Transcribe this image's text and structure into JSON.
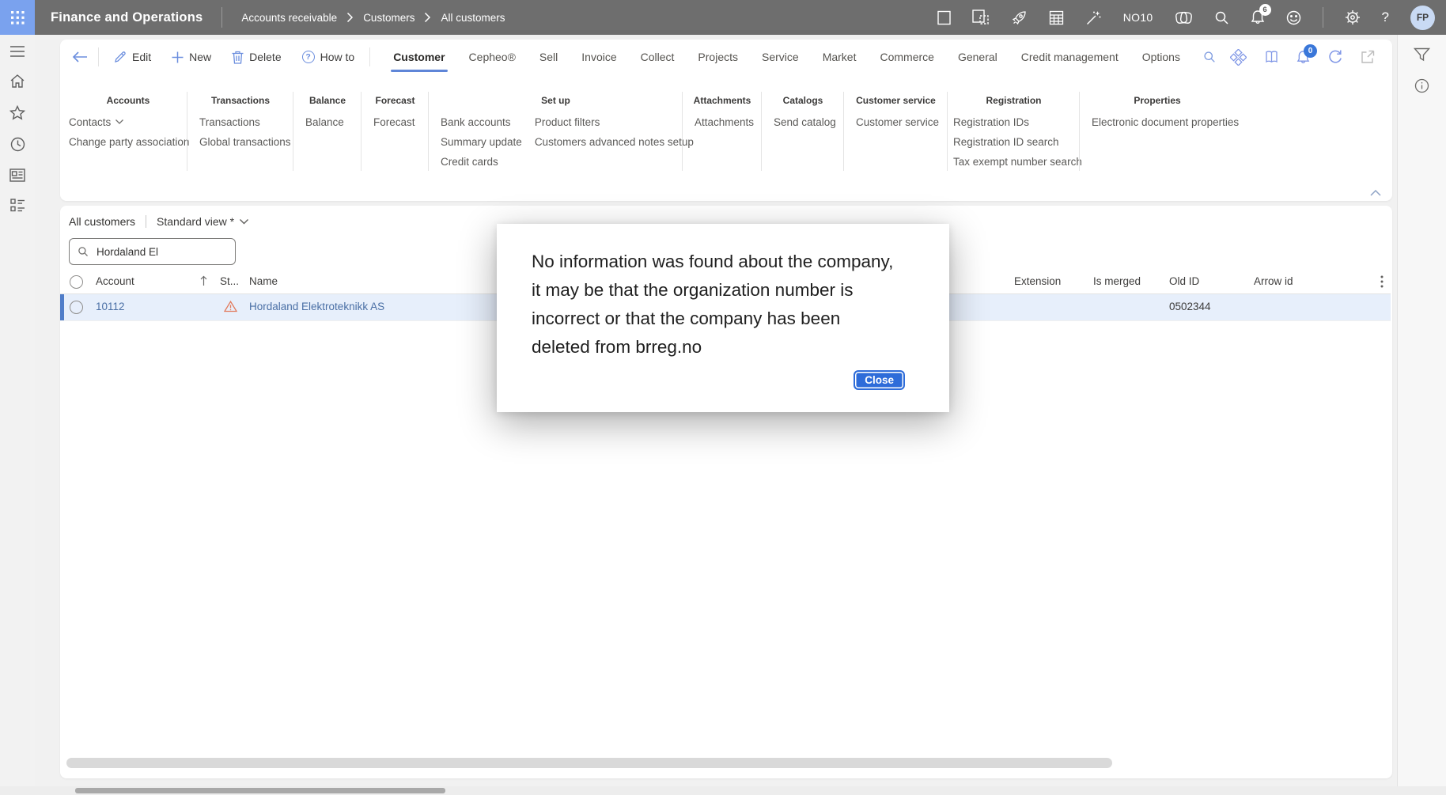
{
  "colors": {
    "navbar": "#6e6e6e",
    "waffle_button": "#7aa2ee",
    "accent_blue": "#5f86d8",
    "link_blue": "#4a6fa5",
    "row_selection": "#e7effb",
    "warning_orange": "#e2795b",
    "dialog_button": "#2e6cd9"
  },
  "icons": {
    "help_glyph": "?"
  },
  "topbar": {
    "app_title": "Finance and Operations",
    "breadcrumb": [
      "Accounts receivable",
      "Customers",
      "All customers"
    ],
    "environment": "NO10",
    "notification_count": "6",
    "user_initials": "FP",
    "icon_names": [
      "fullscreen-icon",
      "devices-icon",
      "rocket-icon",
      "calculator-icon",
      "wand-icon",
      "copilot-icon",
      "search-icon",
      "notifications-bell-icon",
      "feedback-smiley-icon",
      "settings-gear-icon",
      "help-icon",
      "avatar"
    ]
  },
  "sidebar": {
    "icon_names": [
      "menu-hamburger-icon",
      "home-icon",
      "favorites-star-icon",
      "recent-clock-icon",
      "workspaces-icon",
      "modules-icon"
    ]
  },
  "actionbar": {
    "buttons": {
      "edit": "Edit",
      "new": "New",
      "delete": "Delete",
      "howto": "How to"
    },
    "tabs": [
      {
        "label": "Customer",
        "selected": true
      },
      {
        "label": "Cepheo®",
        "selected": false
      },
      {
        "label": "Sell",
        "selected": false
      },
      {
        "label": "Invoice",
        "selected": false
      },
      {
        "label": "Collect",
        "selected": false
      },
      {
        "label": "Projects",
        "selected": false
      },
      {
        "label": "Service",
        "selected": false
      },
      {
        "label": "Market",
        "selected": false
      },
      {
        "label": "Commerce",
        "selected": false
      },
      {
        "label": "General",
        "selected": false
      },
      {
        "label": "Credit management",
        "selected": false
      },
      {
        "label": "Options",
        "selected": false
      }
    ],
    "message_badge": "0",
    "right_icon_names": [
      "apps-diamond-icon",
      "book-icon",
      "messages-bell-icon",
      "refresh-icon",
      "open-in-new-icon"
    ]
  },
  "ribbon": {
    "groups": [
      {
        "title": "Accounts",
        "columns": [
          [
            "Contacts",
            "Change party association"
          ]
        ]
      },
      {
        "title": "Transactions",
        "columns": [
          [
            "Transactions",
            "Global transactions"
          ]
        ]
      },
      {
        "title": "Balance",
        "columns": [
          [
            "Balance"
          ]
        ]
      },
      {
        "title": "Forecast",
        "columns": [
          [
            "Forecast"
          ]
        ]
      },
      {
        "title": "Set up",
        "columns": [
          [
            "Bank accounts",
            "Summary update",
            "Credit cards"
          ],
          [
            "Product filters",
            "Customers advanced notes setup"
          ]
        ]
      },
      {
        "title": "Attachments",
        "columns": [
          [
            "Attachments"
          ]
        ]
      },
      {
        "title": "Catalogs",
        "columns": [
          [
            "Send catalog"
          ]
        ]
      },
      {
        "title": "Customer service",
        "columns": [
          [
            "Customer service"
          ]
        ]
      },
      {
        "title": "Registration",
        "columns": [
          [
            "Registration IDs",
            "Registration ID search",
            "Tax exempt number search"
          ]
        ]
      },
      {
        "title": "Properties",
        "columns": [
          [
            "Electronic document properties"
          ]
        ]
      }
    ]
  },
  "grid": {
    "list_title": "All customers",
    "view_name": "Standard view *",
    "search_value": "Hordaland El",
    "columns": {
      "account": "Account",
      "status": "St...",
      "name": "Name",
      "extension": "Extension",
      "is_merged": "Is merged",
      "old_id": "Old ID",
      "arrow_id": "Arrow id"
    },
    "row": {
      "account": "10112",
      "name": "Hordaland Elektroteknikk AS",
      "old_id": "0502344"
    }
  },
  "dialog": {
    "message": "No information was found about the company, it may be that the organization number is incorrect or that the company has been deleted from brreg.no",
    "close_label": "Close"
  }
}
